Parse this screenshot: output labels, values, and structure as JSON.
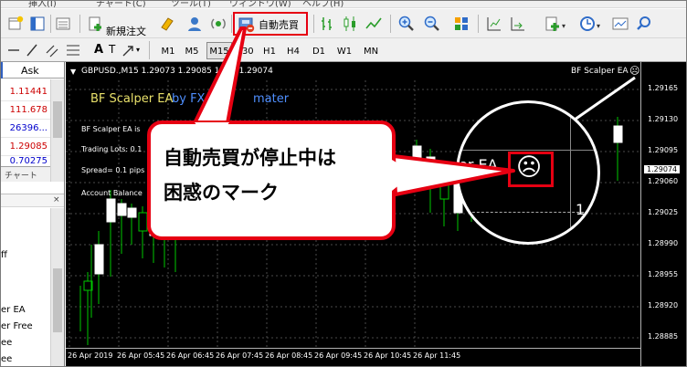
{
  "menu": [
    "挿入(I)",
    "チャート(C)",
    "ツール(T)",
    "ウィンドウ(W)",
    "ヘルプ(H)"
  ],
  "toolbar": {
    "new_order_label": "新規注文",
    "auto_trading_label": "自動売買",
    "auto_trading_state": "stopped"
  },
  "timeframes": [
    "M1",
    "M5",
    "M15",
    "M30",
    "H1",
    "H4",
    "D1",
    "W1",
    "MN"
  ],
  "selected_timeframe": "M15",
  "market_watch": {
    "header": "Ask",
    "asks": [
      "1.11441",
      "111.678",
      "26396...",
      "1.29085",
      "0.70275"
    ],
    "ask_colors": [
      "#cc0000",
      "#cc0000",
      "#0000cc",
      "#cc0000",
      "#0000cc"
    ],
    "tab_label": "チャート"
  },
  "navigator": {
    "items": [
      "ff",
      "er EA",
      "er Free",
      "ee",
      "ee"
    ]
  },
  "chart": {
    "header": "GBPUSD.,M15  1.29073 1.29085 1.29073 1.29074",
    "header_shown_left": "GBPUSD.,M15  1.29073 1.29085 1.29",
    "header_shown_right": "5 1.29074",
    "ea_title": "BF Scalper EA",
    "ea_title_suffix_shown": "by FX",
    "ea_title_tail_shown": "mater",
    "ea_status_line": "BF Scalper EA is",
    "trading_lots": "Trading Lots:  0.1",
    "spread": "Spread= 0.1 pips",
    "account_balance": "Account Balance",
    "expert_label": "BF Scalper EA",
    "expert_state_icon": "frown-face-icon",
    "price_axis": [
      "1.29165",
      "1.29130",
      "1.29095",
      "1.29060",
      "1.29025",
      "1.28990",
      "1.28955",
      "1.28920",
      "1.28885"
    ],
    "current_price": "1.29074",
    "time_axis": [
      "26 Apr 2019",
      "26 Apr 05:45",
      "26 Apr 06:45",
      "26 Apr 07:45",
      "26 Apr 08:45",
      "26 Apr 09:45",
      "26 Apr 10:45",
      "26 Apr 11:45"
    ],
    "zoom_label_text": "er EA",
    "zoom_axis_fragment": "1",
    "colors": {
      "background": "#000000",
      "bull_body": "#ffffff",
      "wick": "#00c800",
      "grid": "#4a4a4a",
      "ea_title": "#e8e06a",
      "ea_suffix": "#4f8fff",
      "accent": "#e60012"
    }
  },
  "callout": {
    "line1": "自動売買が停止中は",
    "line2": "困惑のマーク"
  }
}
